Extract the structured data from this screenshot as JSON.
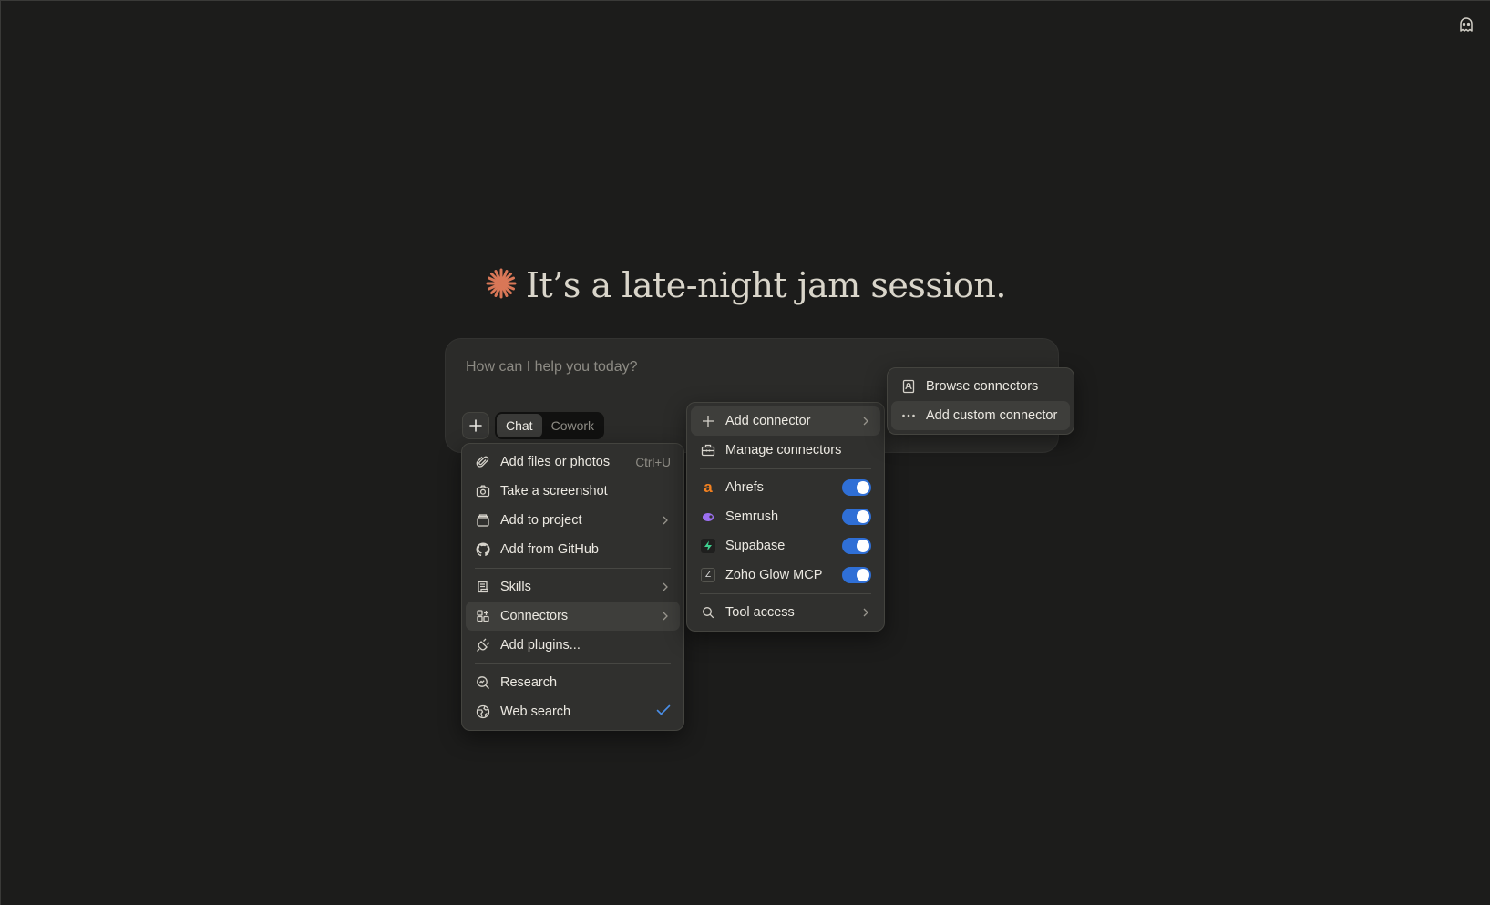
{
  "greeting": {
    "text": "It’s a late-night jam session.",
    "accent_color": "#d97757"
  },
  "composer": {
    "placeholder": "How can I help you today?",
    "modes": [
      "Chat",
      "Cowork"
    ],
    "active_mode": "Chat"
  },
  "main_menu": {
    "items": [
      {
        "label": "Add files or photos",
        "icon": "paperclip-icon",
        "shortcut": "Ctrl+U"
      },
      {
        "label": "Take a screenshot",
        "icon": "camera-icon"
      },
      {
        "label": "Add to project",
        "icon": "project-box-icon",
        "submenu": true
      },
      {
        "label": "Add from GitHub",
        "icon": "github-icon"
      },
      {
        "label": "Skills",
        "icon": "skills-icon",
        "submenu": true
      },
      {
        "label": "Connectors",
        "icon": "connectors-icon",
        "submenu": true,
        "highlighted": true
      },
      {
        "label": "Add plugins...",
        "icon": "plug-icon"
      },
      {
        "label": "Research",
        "icon": "research-icon"
      },
      {
        "label": "Web search",
        "icon": "globe-icon",
        "checked": true
      }
    ]
  },
  "connectors_menu": {
    "add_connector": "Add connector",
    "manage_connectors": "Manage connectors",
    "connectors": [
      {
        "label": "Ahrefs",
        "icon": "ahrefs-logo-icon",
        "enabled": true
      },
      {
        "label": "Semrush",
        "icon": "semrush-logo-icon",
        "enabled": true
      },
      {
        "label": "Supabase",
        "icon": "supabase-logo-icon",
        "enabled": true
      },
      {
        "label": "Zoho Glow MCP",
        "icon": "zoho-logo-icon",
        "enabled": true
      }
    ],
    "tool_access": "Tool access"
  },
  "add_connector_menu": {
    "browse": "Browse connectors",
    "custom": "Add custom connector"
  },
  "colors": {
    "toggle_on": "#2f6fd6",
    "check": "#4a8ee8"
  }
}
